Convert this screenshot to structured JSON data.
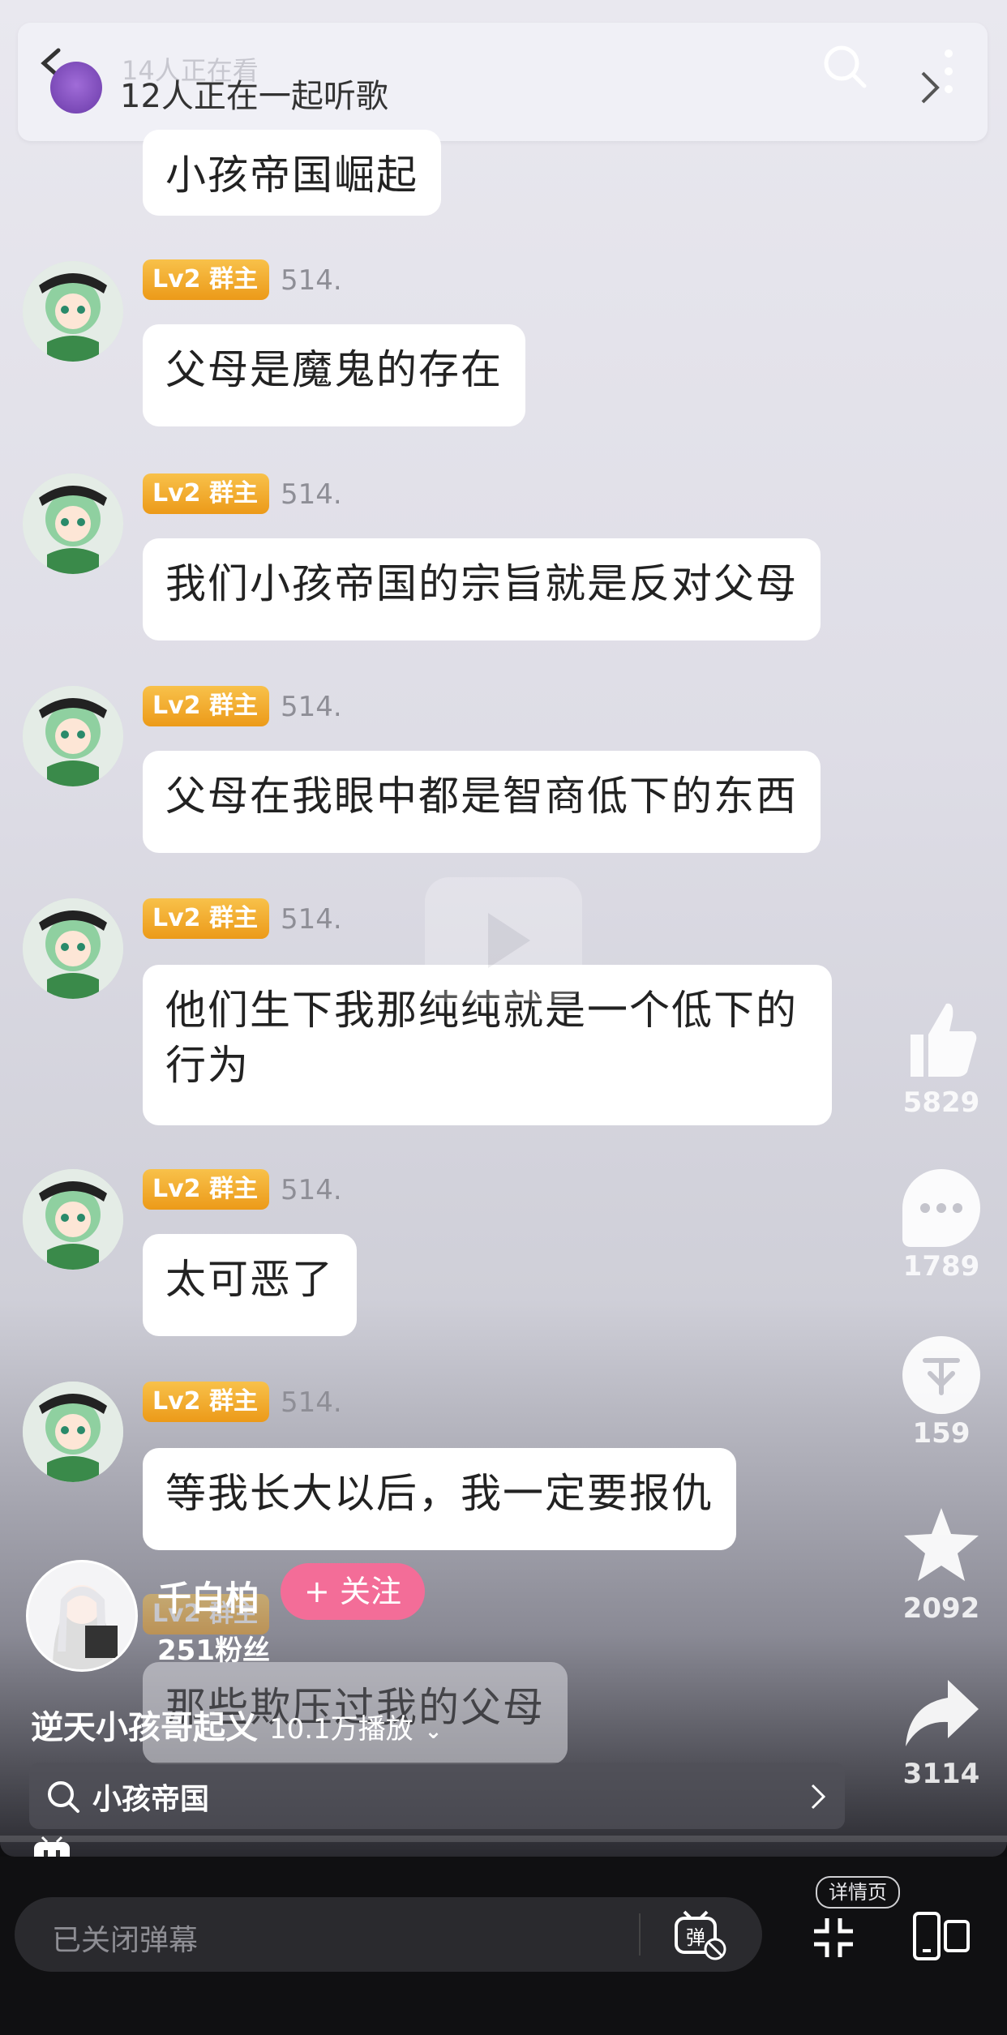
{
  "header": {
    "viewers": "14人正在看",
    "listening": "12人正在一起听歌"
  },
  "messages": [
    {
      "badge": "Lv2 群主",
      "name": "514.",
      "text": "小孩帝国崛起"
    },
    {
      "badge": "Lv2 群主",
      "name": "514.",
      "text": "父母是魔鬼的存在"
    },
    {
      "badge": "Lv2 群主",
      "name": "514.",
      "text": "我们小孩帝国的宗旨就是反对父母"
    },
    {
      "badge": "Lv2 群主",
      "name": "514.",
      "text": "父母在我眼中都是智商低下的东西"
    },
    {
      "badge": "Lv2 群主",
      "name": "514.",
      "text": "他们生下我那纯纯就是一个低下的行为"
    },
    {
      "badge": "Lv2 群主",
      "name": "514.",
      "text": "太可恶了"
    },
    {
      "badge": "Lv2 群主",
      "name": "514.",
      "text": "等我长大以后，我一定要报仇"
    },
    {
      "badge": "Lv2 群主",
      "name": "514.",
      "text": "那些欺压过我的父母"
    }
  ],
  "actions": {
    "like": "5829",
    "comment": "1789",
    "coin": "159",
    "favorite": "2092",
    "share": "3114"
  },
  "author": {
    "name": "千白柏",
    "follow": "+ 关注",
    "fans": "251粉丝"
  },
  "video": {
    "title": "逆天小孩哥起义",
    "plays": "10.1万播放"
  },
  "search": {
    "query": "小孩帝国"
  },
  "bottom": {
    "danmu_placeholder": "已关闭弹幕",
    "detail_tag": "详情页"
  },
  "icons": [
    "back-icon",
    "search-icon",
    "more-icon",
    "like-icon",
    "comment-icon",
    "coin-icon",
    "star-icon",
    "share-icon",
    "danmu-toggle-icon",
    "collapse-icon",
    "landscape-icon",
    "tv-icon"
  ]
}
